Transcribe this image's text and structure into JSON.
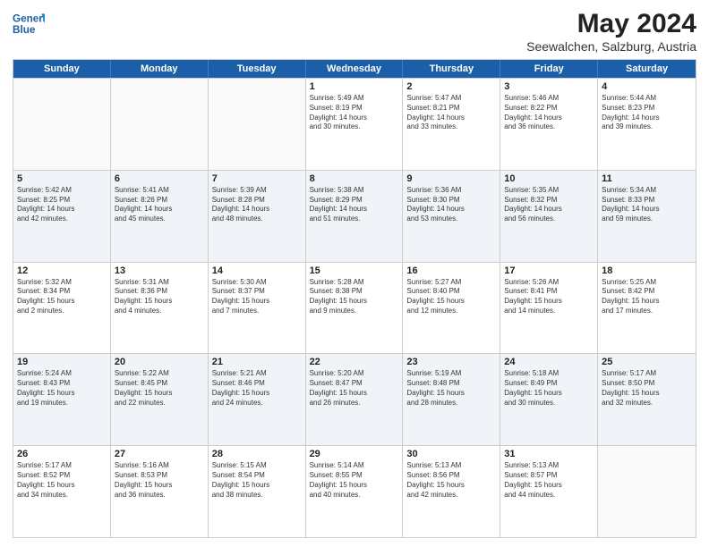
{
  "header": {
    "logo_line1": "General",
    "logo_line2": "Blue",
    "title": "May 2024",
    "subtitle": "Seewalchen, Salzburg, Austria"
  },
  "weekdays": [
    "Sunday",
    "Monday",
    "Tuesday",
    "Wednesday",
    "Thursday",
    "Friday",
    "Saturday"
  ],
  "weeks": [
    [
      {
        "day": "",
        "info": ""
      },
      {
        "day": "",
        "info": ""
      },
      {
        "day": "",
        "info": ""
      },
      {
        "day": "1",
        "info": "Sunrise: 5:49 AM\nSunset: 8:19 PM\nDaylight: 14 hours\nand 30 minutes."
      },
      {
        "day": "2",
        "info": "Sunrise: 5:47 AM\nSunset: 8:21 PM\nDaylight: 14 hours\nand 33 minutes."
      },
      {
        "day": "3",
        "info": "Sunrise: 5:46 AM\nSunset: 8:22 PM\nDaylight: 14 hours\nand 36 minutes."
      },
      {
        "day": "4",
        "info": "Sunrise: 5:44 AM\nSunset: 8:23 PM\nDaylight: 14 hours\nand 39 minutes."
      }
    ],
    [
      {
        "day": "5",
        "info": "Sunrise: 5:42 AM\nSunset: 8:25 PM\nDaylight: 14 hours\nand 42 minutes."
      },
      {
        "day": "6",
        "info": "Sunrise: 5:41 AM\nSunset: 8:26 PM\nDaylight: 14 hours\nand 45 minutes."
      },
      {
        "day": "7",
        "info": "Sunrise: 5:39 AM\nSunset: 8:28 PM\nDaylight: 14 hours\nand 48 minutes."
      },
      {
        "day": "8",
        "info": "Sunrise: 5:38 AM\nSunset: 8:29 PM\nDaylight: 14 hours\nand 51 minutes."
      },
      {
        "day": "9",
        "info": "Sunrise: 5:36 AM\nSunset: 8:30 PM\nDaylight: 14 hours\nand 53 minutes."
      },
      {
        "day": "10",
        "info": "Sunrise: 5:35 AM\nSunset: 8:32 PM\nDaylight: 14 hours\nand 56 minutes."
      },
      {
        "day": "11",
        "info": "Sunrise: 5:34 AM\nSunset: 8:33 PM\nDaylight: 14 hours\nand 59 minutes."
      }
    ],
    [
      {
        "day": "12",
        "info": "Sunrise: 5:32 AM\nSunset: 8:34 PM\nDaylight: 15 hours\nand 2 minutes."
      },
      {
        "day": "13",
        "info": "Sunrise: 5:31 AM\nSunset: 8:36 PM\nDaylight: 15 hours\nand 4 minutes."
      },
      {
        "day": "14",
        "info": "Sunrise: 5:30 AM\nSunset: 8:37 PM\nDaylight: 15 hours\nand 7 minutes."
      },
      {
        "day": "15",
        "info": "Sunrise: 5:28 AM\nSunset: 8:38 PM\nDaylight: 15 hours\nand 9 minutes."
      },
      {
        "day": "16",
        "info": "Sunrise: 5:27 AM\nSunset: 8:40 PM\nDaylight: 15 hours\nand 12 minutes."
      },
      {
        "day": "17",
        "info": "Sunrise: 5:26 AM\nSunset: 8:41 PM\nDaylight: 15 hours\nand 14 minutes."
      },
      {
        "day": "18",
        "info": "Sunrise: 5:25 AM\nSunset: 8:42 PM\nDaylight: 15 hours\nand 17 minutes."
      }
    ],
    [
      {
        "day": "19",
        "info": "Sunrise: 5:24 AM\nSunset: 8:43 PM\nDaylight: 15 hours\nand 19 minutes."
      },
      {
        "day": "20",
        "info": "Sunrise: 5:22 AM\nSunset: 8:45 PM\nDaylight: 15 hours\nand 22 minutes."
      },
      {
        "day": "21",
        "info": "Sunrise: 5:21 AM\nSunset: 8:46 PM\nDaylight: 15 hours\nand 24 minutes."
      },
      {
        "day": "22",
        "info": "Sunrise: 5:20 AM\nSunset: 8:47 PM\nDaylight: 15 hours\nand 26 minutes."
      },
      {
        "day": "23",
        "info": "Sunrise: 5:19 AM\nSunset: 8:48 PM\nDaylight: 15 hours\nand 28 minutes."
      },
      {
        "day": "24",
        "info": "Sunrise: 5:18 AM\nSunset: 8:49 PM\nDaylight: 15 hours\nand 30 minutes."
      },
      {
        "day": "25",
        "info": "Sunrise: 5:17 AM\nSunset: 8:50 PM\nDaylight: 15 hours\nand 32 minutes."
      }
    ],
    [
      {
        "day": "26",
        "info": "Sunrise: 5:17 AM\nSunset: 8:52 PM\nDaylight: 15 hours\nand 34 minutes."
      },
      {
        "day": "27",
        "info": "Sunrise: 5:16 AM\nSunset: 8:53 PM\nDaylight: 15 hours\nand 36 minutes."
      },
      {
        "day": "28",
        "info": "Sunrise: 5:15 AM\nSunset: 8:54 PM\nDaylight: 15 hours\nand 38 minutes."
      },
      {
        "day": "29",
        "info": "Sunrise: 5:14 AM\nSunset: 8:55 PM\nDaylight: 15 hours\nand 40 minutes."
      },
      {
        "day": "30",
        "info": "Sunrise: 5:13 AM\nSunset: 8:56 PM\nDaylight: 15 hours\nand 42 minutes."
      },
      {
        "day": "31",
        "info": "Sunrise: 5:13 AM\nSunset: 8:57 PM\nDaylight: 15 hours\nand 44 minutes."
      },
      {
        "day": "",
        "info": ""
      }
    ]
  ]
}
